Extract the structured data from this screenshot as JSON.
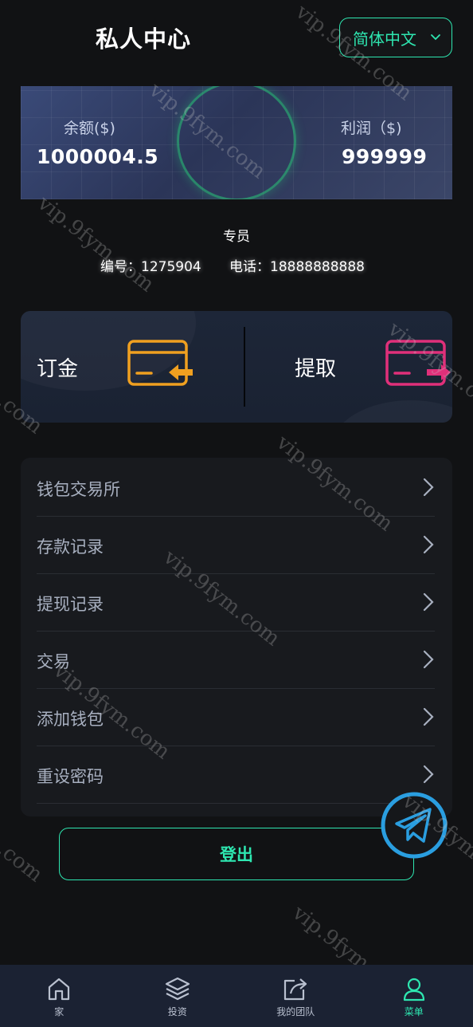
{
  "header": {
    "title": "私人中心",
    "language": "简体中文"
  },
  "balance": {
    "balance_label": "余额($)",
    "balance_value": "1000004.5",
    "profit_label": "利润（$)",
    "profit_value": "999999"
  },
  "member": {
    "level": "专员",
    "id_label": "编号：",
    "id_value": "1275904",
    "phone_label": "电话：",
    "phone_value": "18888888888"
  },
  "actions": {
    "deposit_label": "订金",
    "withdraw_label": "提取"
  },
  "menu": {
    "items": [
      {
        "label": "钱包交易所"
      },
      {
        "label": "存款记录"
      },
      {
        "label": "提现记录"
      },
      {
        "label": "交易"
      },
      {
        "label": "添加钱包"
      },
      {
        "label": "重设密码"
      }
    ]
  },
  "logout_label": "登出",
  "watermark_text": "vip.9fym.com",
  "nav": {
    "items": [
      {
        "label": "家",
        "icon": "home-icon"
      },
      {
        "label": "投资",
        "icon": "layers-icon"
      },
      {
        "label": "我的团队",
        "icon": "share-icon"
      },
      {
        "label": "菜单",
        "icon": "user-icon"
      }
    ]
  },
  "colors": {
    "accent": "#2ee6b0",
    "deposit_icon": "#f0a020",
    "withdraw_icon": "#e0307a",
    "telegram": "#2a9ee0"
  }
}
